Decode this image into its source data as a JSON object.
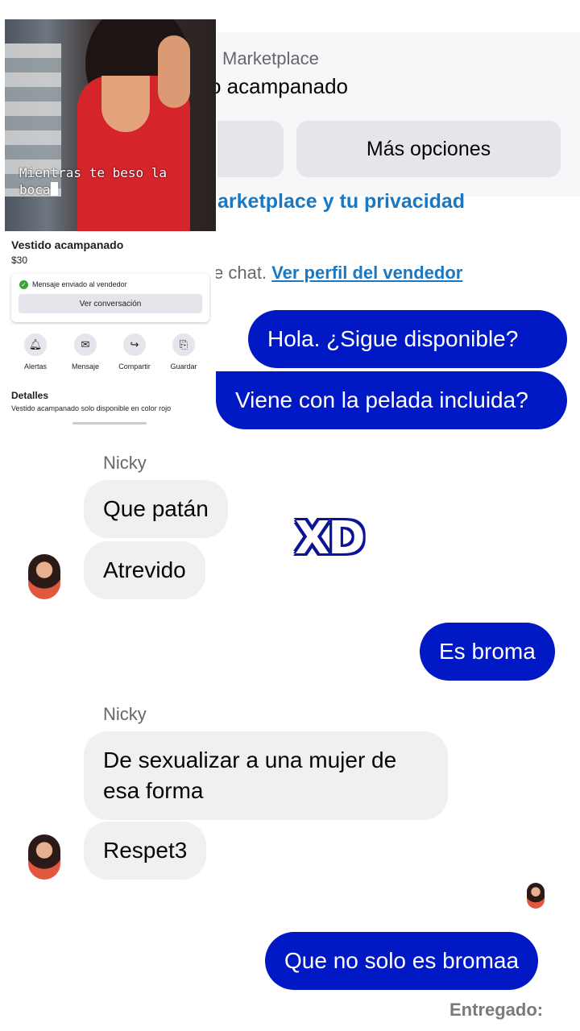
{
  "header": {
    "close_icon": "✕",
    "search_icon": "⌕",
    "more_icon": "···"
  },
  "marketplace_card": {
    "label": "Marketplace",
    "title_partial": "o acampanado",
    "more_options": "Más opciones"
  },
  "privacy_link": "arketplace y tu privacidad",
  "chat_note": {
    "prefix": "e chat.",
    "seller_link": "Ver perfil del vendedor"
  },
  "messages": {
    "m1": "Hola. ¿Sigue disponible?",
    "m2": "Viene con la pelada incluida?",
    "sender1": "Nicky",
    "m3": "Que patán",
    "m4": "Atrevido",
    "m5": "Es broma",
    "sender2": "Nicky",
    "m6": "De sexualizar a una mujer de esa forma",
    "m7": "Respet3",
    "m8": "Que no solo es bromaa",
    "status": "Entregado:"
  },
  "sticker_text": "XD",
  "overlay": {
    "photo_caption": "Mientras te beso la boca",
    "product_title": "Vestido acampanado",
    "product_price": "$30",
    "sent_text": "Mensaje enviado al vendedor",
    "view_conversation": "Ver conversación",
    "actions": [
      {
        "label": "Alertas",
        "icon": "bell-icon",
        "glyph": "🔔︎"
      },
      {
        "label": "Mensaje",
        "icon": "messenger-icon",
        "glyph": "✉"
      },
      {
        "label": "Compartir",
        "icon": "share-icon",
        "glyph": "↪"
      },
      {
        "label": "Guardar",
        "icon": "bookmark-icon",
        "glyph": "⎘"
      }
    ],
    "details_title": "Detalles",
    "details_text": "Vestido acampanado solo disponible en color rojo"
  },
  "colors": {
    "outgoing_bubble": "#0019c5",
    "incoming_bubble": "#f0f0f0",
    "link": "#1a78c2"
  }
}
